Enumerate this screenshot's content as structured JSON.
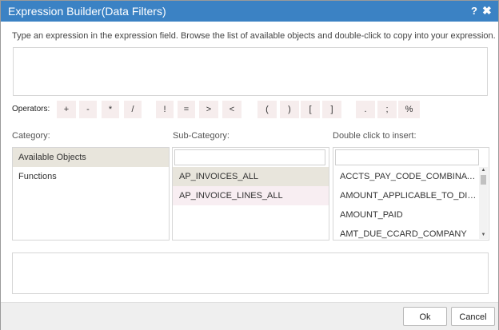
{
  "dialog": {
    "title": "Expression Builder(Data Filters)",
    "help_label": "?",
    "close_label": "✖"
  },
  "instructions": "Type an expression in the expression field. Browse the list of available objects and double-click to copy into your expression.",
  "expression": {
    "value": ""
  },
  "operators": {
    "label": "Operators:",
    "items": [
      "+",
      "-",
      "*",
      "/",
      "!",
      "=",
      ">",
      "<",
      "(",
      ")",
      "[",
      "]",
      ".",
      ";",
      "%"
    ]
  },
  "category": {
    "label": "Category:",
    "items": [
      "Available Objects",
      "Functions"
    ],
    "selected": "Available Objects"
  },
  "subcategory": {
    "label": "Sub-Category:",
    "search_value": "",
    "items": [
      "AP_INVOICES_ALL",
      "AP_INVOICE_LINES_ALL"
    ],
    "selected": "AP_INVOICES_ALL"
  },
  "insert": {
    "label": "Double click to insert:",
    "search_value": "",
    "items": [
      "ACCTS_PAY_CODE_COMBINATION_ID",
      "AMOUNT_APPLICABLE_TO_DISCOUNT",
      "AMOUNT_PAID",
      "AMT_DUE_CCARD_COMPANY"
    ],
    "scroll_up": "▲",
    "scroll_down": "▼"
  },
  "buttons": {
    "ok_label": "Ok",
    "cancel_label": "Cancel"
  },
  "colors": {
    "titlebar": "#3b82c4",
    "operator_bg": "#f6eded",
    "selected_row": "#e8e5dc",
    "alt_row": "#f8eef2"
  }
}
